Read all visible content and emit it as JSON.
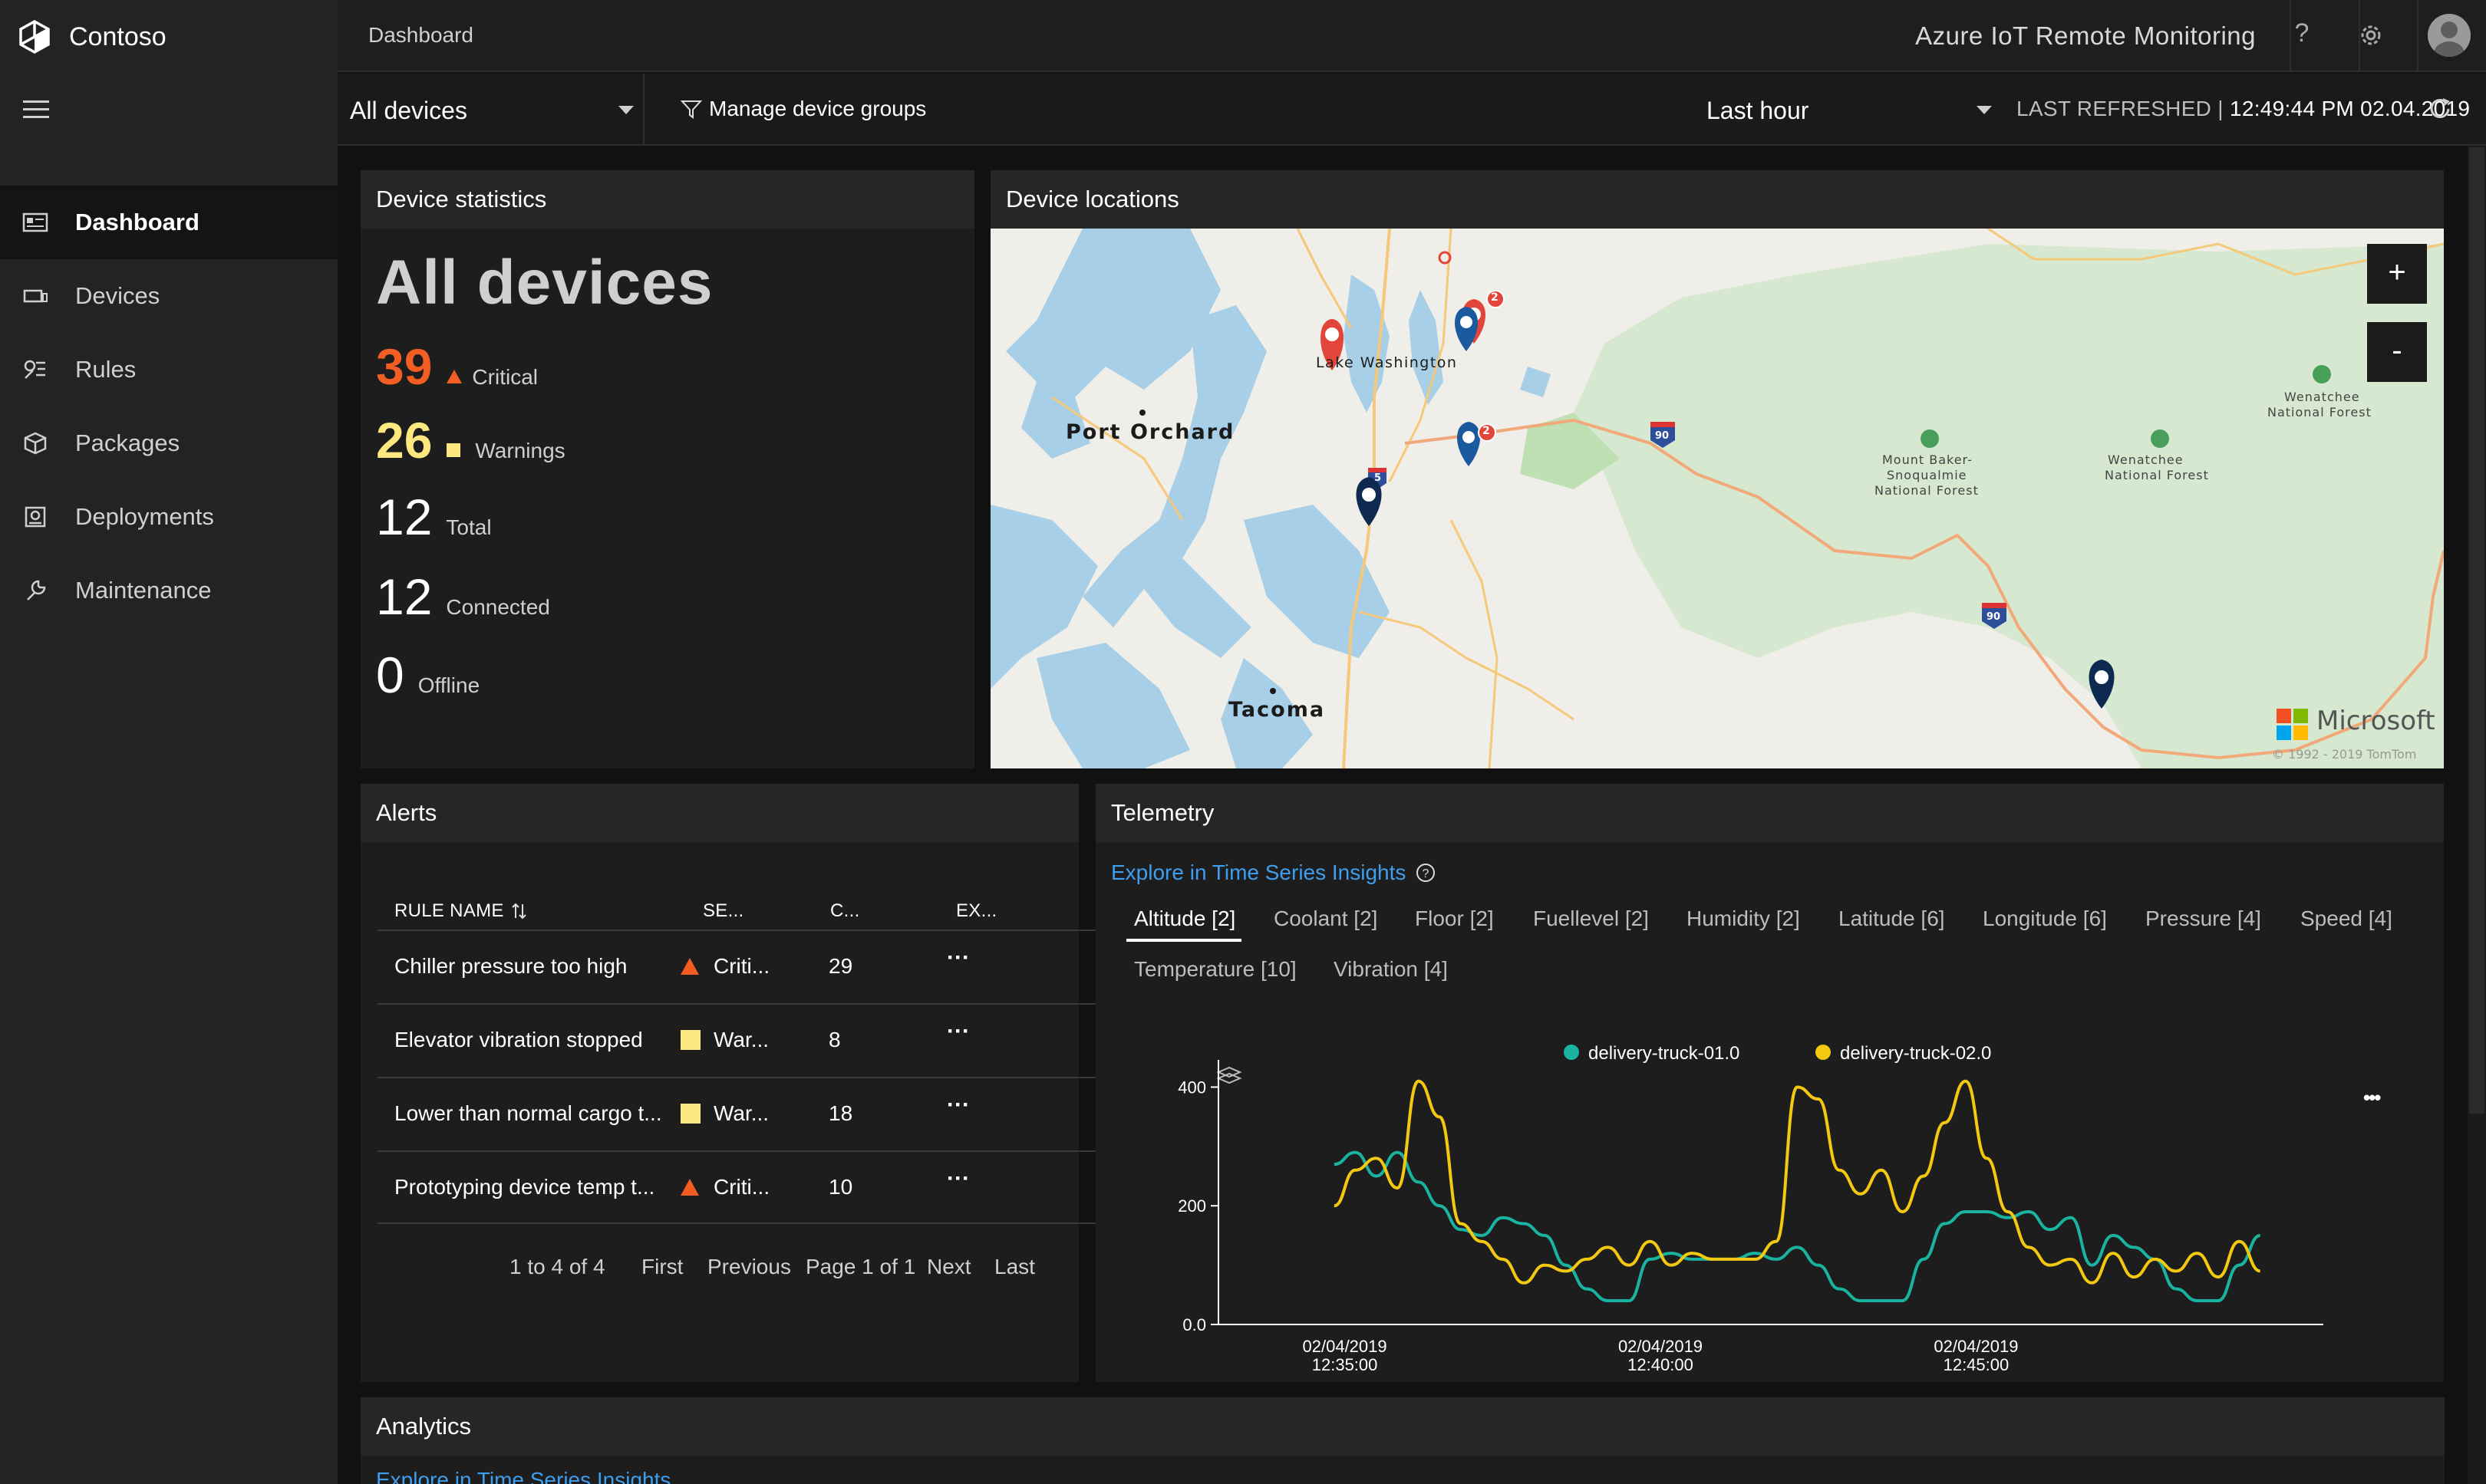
{
  "brand": {
    "name": "Contoso"
  },
  "nav": {
    "items": [
      {
        "label": "Dashboard",
        "icon": "dashboard-icon",
        "active": true
      },
      {
        "label": "Devices",
        "icon": "devices-icon"
      },
      {
        "label": "Rules",
        "icon": "rules-icon"
      },
      {
        "label": "Packages",
        "icon": "packages-icon"
      },
      {
        "label": "Deployments",
        "icon": "deployments-icon"
      },
      {
        "label": "Maintenance",
        "icon": "maintenance-icon"
      }
    ]
  },
  "header": {
    "breadcrumb": "Dashboard",
    "app_title": "Azure IoT Remote Monitoring",
    "help_glyph": "?"
  },
  "filters": {
    "device_group": "All devices",
    "manage_label": "Manage device groups",
    "time_range": "Last hour",
    "last_refreshed_label": "LAST REFRESHED",
    "last_refreshed_sep": "|",
    "last_refreshed_value": "12:49:44 PM 02.04.2019"
  },
  "device_statistics": {
    "title": "Device statistics",
    "heading": "All devices",
    "critical": {
      "value": "39",
      "label": "Critical"
    },
    "warnings": {
      "value": "26",
      "label": "Warnings"
    },
    "total": {
      "value": "12",
      "label": "Total"
    },
    "connected": {
      "value": "12",
      "label": "Connected"
    },
    "offline": {
      "value": "0",
      "label": "Offline"
    }
  },
  "device_locations": {
    "title": "Device locations",
    "zoom_in": "+",
    "zoom_out": "-",
    "labels": {
      "lake": "Lake Washington",
      "port_orchard": "Port Orchard",
      "tacoma": "Tacoma",
      "forest1_a": "Mount Baker-",
      "forest1_b": "Snoqualmie",
      "forest1_c": "National Forest",
      "forest2_a": "Wenatchee",
      "forest2_b": "National Forest",
      "forest3_a": "Wenatchee",
      "forest3_b": "National Forest",
      "hw90a": "90",
      "hw90b": "90",
      "hw5": "5",
      "cluster1": "2",
      "cluster2": "2",
      "attribution_brand": "Microsoft",
      "attribution": "© 1992 - 2019 TomTom"
    }
  },
  "alerts": {
    "title": "Alerts",
    "columns": [
      "RULE NAME",
      "SE...",
      "C...",
      "EX..."
    ],
    "sort_icon": "sort-icon",
    "rows": [
      {
        "rule": "Chiller pressure too high",
        "severity": "Criti...",
        "severity_type": "critical",
        "count": "29",
        "more": "···"
      },
      {
        "rule": "Elevator vibration stopped",
        "severity": "War...",
        "severity_type": "warning",
        "count": "8",
        "more": "···"
      },
      {
        "rule": "Lower than normal cargo t...",
        "severity": "War...",
        "severity_type": "warning",
        "count": "18",
        "more": "···"
      },
      {
        "rule": "Prototyping device temp t...",
        "severity": "Criti...",
        "severity_type": "critical",
        "count": "10",
        "more": "···"
      }
    ],
    "pager": {
      "range": "1 to 4 of 4",
      "first": "First",
      "previous": "Previous",
      "page": "Page 1 of 1",
      "next": "Next",
      "last": "Last"
    }
  },
  "telemetry": {
    "title": "Telemetry",
    "tsi_link": "Explore in Time Series Insights",
    "tabs": [
      "Altitude [2]",
      "Coolant [2]",
      "Floor [2]",
      "Fuellevel [2]",
      "Humidity [2]",
      "Latitude [6]",
      "Longitude [6]",
      "Pressure [4]",
      "Speed [4]",
      "Temperature [10]",
      "Vibration [4]"
    ],
    "selected_tab": "Altitude [2]",
    "more": "•••"
  },
  "chart_data": {
    "type": "line",
    "title": "",
    "xlabel": "",
    "ylabel": "",
    "ylim": [
      0,
      420
    ],
    "yticks": [
      "400",
      "200",
      "0.0"
    ],
    "xtick_labels": [
      {
        "date": "02/04/2019",
        "time": "12:35:00"
      },
      {
        "date": "02/04/2019",
        "time": "12:40:00"
      },
      {
        "date": "02/04/2019",
        "time": "12:45:00"
      }
    ],
    "legend_position": "top-center",
    "series": [
      {
        "name": "delivery-truck-01.0",
        "color": "#1ab39f",
        "x": [
          "12:34:50",
          "12:35:10",
          "12:35:30",
          "12:35:50",
          "12:36:10",
          "12:36:30",
          "12:36:50",
          "12:37:10",
          "12:37:30",
          "12:37:50",
          "12:38:10",
          "12:38:30",
          "12:38:50",
          "12:39:10",
          "12:39:30",
          "12:39:50",
          "12:40:10",
          "12:40:30",
          "12:40:50",
          "12:41:10",
          "12:41:30",
          "12:41:50",
          "12:42:10",
          "12:42:30",
          "12:42:50",
          "12:43:10",
          "12:43:30",
          "12:43:50",
          "12:44:10",
          "12:44:30",
          "12:44:50",
          "12:45:10",
          "12:45:30",
          "12:45:50",
          "12:46:10",
          "12:46:30",
          "12:46:50",
          "12:47:10",
          "12:47:30",
          "12:47:50",
          "12:48:10",
          "12:48:30",
          "12:48:50",
          "12:49:10",
          "12:49:30"
        ],
        "values": [
          270,
          290,
          250,
          290,
          240,
          200,
          160,
          150,
          180,
          170,
          150,
          100,
          60,
          40,
          40,
          110,
          120,
          110,
          110,
          110,
          120,
          110,
          130,
          100,
          60,
          40,
          40,
          40,
          110,
          170,
          190,
          190,
          180,
          190,
          160,
          180,
          100,
          150,
          130,
          110,
          60,
          40,
          40,
          100,
          150
        ]
      },
      {
        "name": "delivery-truck-02.0",
        "color": "#f2c811",
        "x": [
          "12:34:50",
          "12:35:10",
          "12:35:30",
          "12:35:50",
          "12:36:10",
          "12:36:30",
          "12:36:50",
          "12:37:10",
          "12:37:30",
          "12:37:50",
          "12:38:10",
          "12:38:30",
          "12:38:50",
          "12:39:10",
          "12:39:30",
          "12:39:50",
          "12:40:10",
          "12:40:30",
          "12:40:50",
          "12:41:10",
          "12:41:30",
          "12:41:50",
          "12:42:10",
          "12:42:30",
          "12:42:50",
          "12:43:10",
          "12:43:30",
          "12:43:50",
          "12:44:10",
          "12:44:30",
          "12:44:50",
          "12:45:10",
          "12:45:30",
          "12:45:50",
          "12:46:10",
          "12:46:30",
          "12:46:50",
          "12:47:10",
          "12:47:30",
          "12:47:50",
          "12:48:10",
          "12:48:30",
          "12:48:50",
          "12:49:10",
          "12:49:30"
        ],
        "values": [
          200,
          260,
          280,
          230,
          410,
          350,
          170,
          140,
          110,
          70,
          100,
          90,
          110,
          130,
          100,
          140,
          100,
          120,
          110,
          110,
          110,
          140,
          400,
          380,
          260,
          220,
          260,
          190,
          250,
          340,
          410,
          280,
          190,
          130,
          100,
          110,
          70,
          120,
          80,
          110,
          90,
          120,
          80,
          140,
          90
        ]
      }
    ]
  },
  "analytics": {
    "title": "Analytics",
    "tsi_link": "Explore in Time Series Insights"
  },
  "colors": {
    "accent": "#3e9ef0",
    "critical": "#f15d22",
    "warning": "#fde87f",
    "sidebar": "#232323"
  }
}
